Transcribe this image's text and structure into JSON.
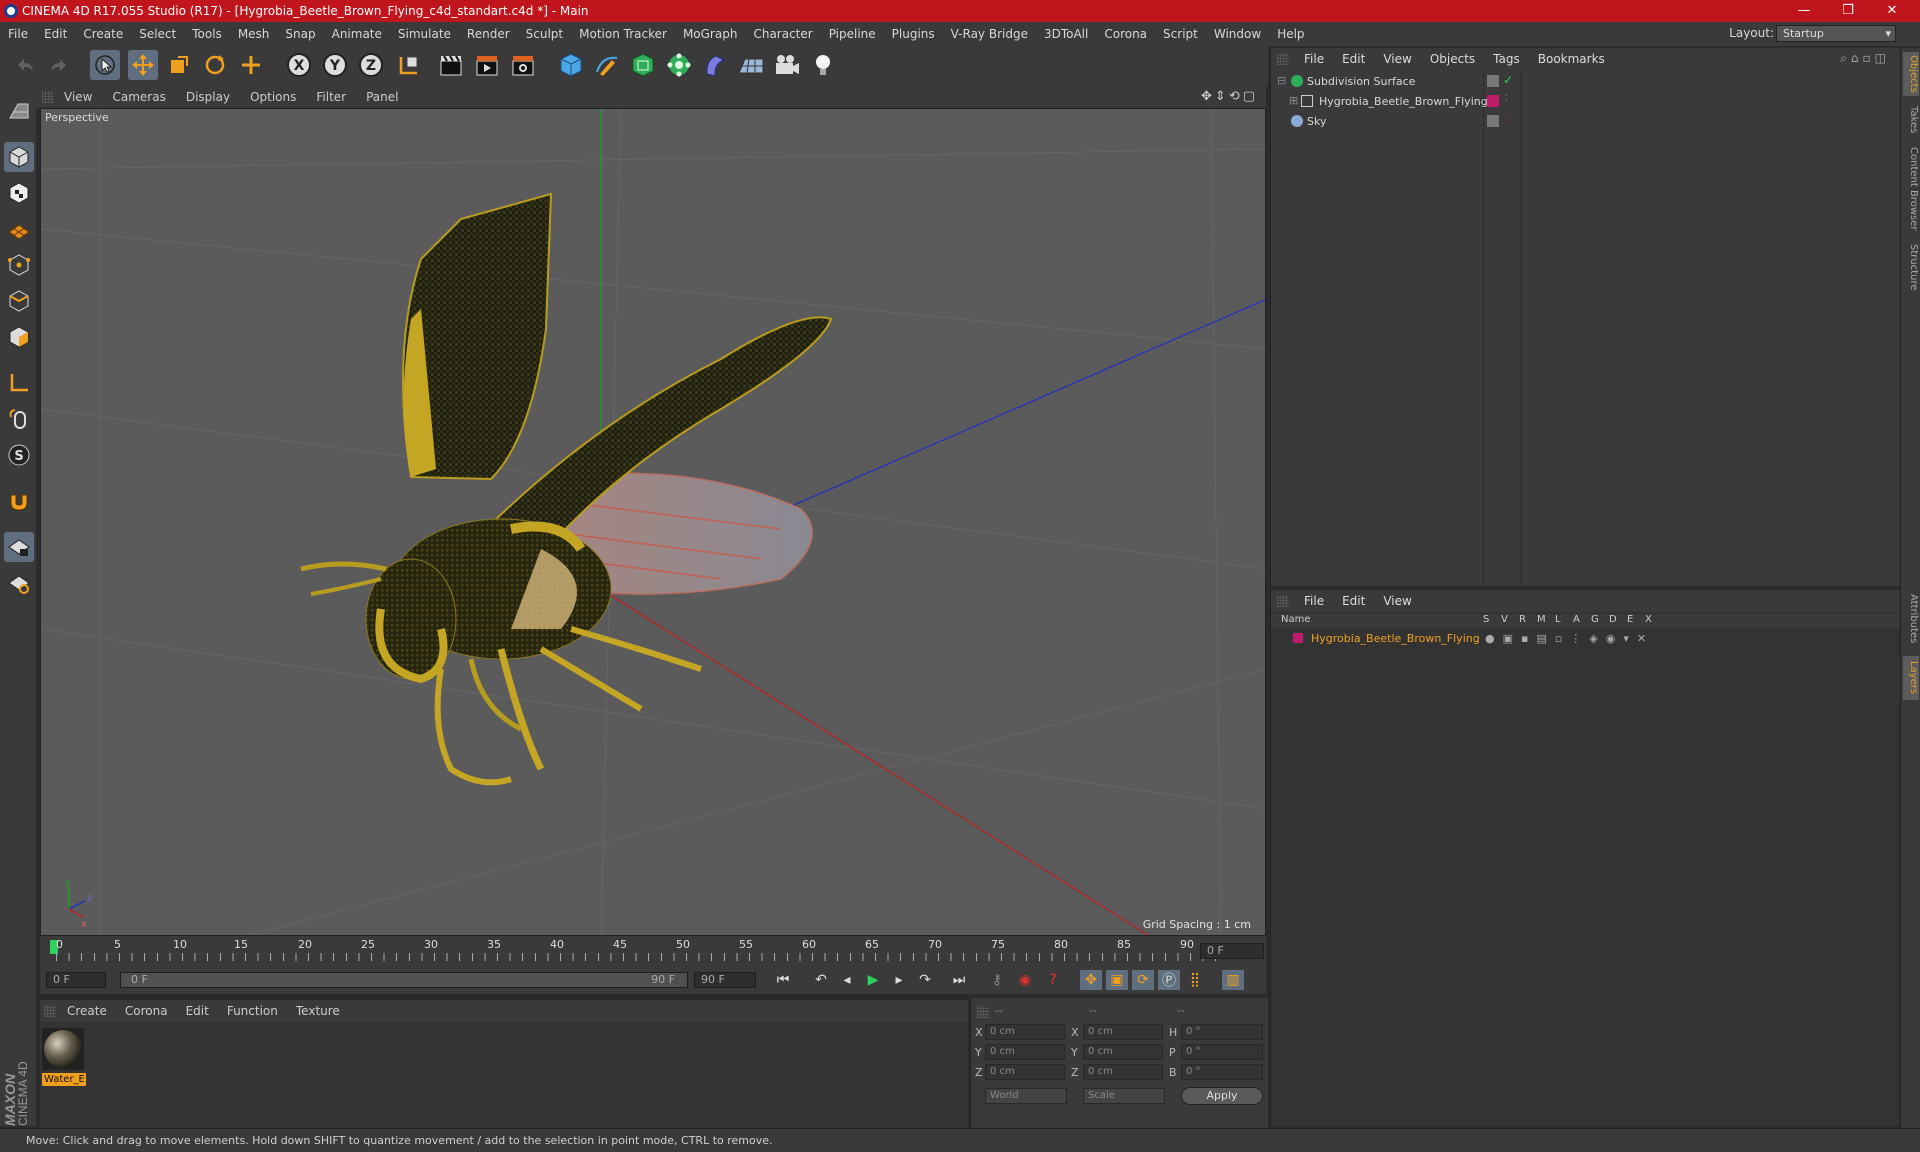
{
  "window": {
    "title": "CINEMA 4D R17.055 Studio (R17) - [Hygrobia_Beetle_Brown_Flying_c4d_standart.c4d *] - Main",
    "minimize": "—",
    "maximize": "❐",
    "close": "✕"
  },
  "menubar": {
    "items": [
      "File",
      "Edit",
      "Create",
      "Select",
      "Tools",
      "Mesh",
      "Snap",
      "Animate",
      "Simulate",
      "Render",
      "Sculpt",
      "Motion Tracker",
      "MoGraph",
      "Character",
      "Pipeline",
      "Plugins",
      "V-Ray Bridge",
      "3DToAll",
      "Corona",
      "Script",
      "Window",
      "Help"
    ],
    "layout_label": "Layout:",
    "layout_value": "Startup"
  },
  "toolbar": {
    "axis_x": "X",
    "axis_y": "Y",
    "axis_z": "Z"
  },
  "viewport": {
    "menu": [
      "View",
      "Cameras",
      "Display",
      "Options",
      "Filter",
      "Panel"
    ],
    "label": "Perspective",
    "grid_spacing": "Grid Spacing : 1 cm",
    "axis_y": "y",
    "axis_z": "z",
    "axis_x": "x"
  },
  "timeline": {
    "ticks": [
      "0",
      "5",
      "10",
      "15",
      "20",
      "25",
      "30",
      "35",
      "40",
      "45",
      "50",
      "55",
      "60",
      "65",
      "70",
      "75",
      "80",
      "85",
      "90"
    ],
    "current_frame": "0 F",
    "start_field": "0 F",
    "range_start": "0 F",
    "range_end": "90 F",
    "end_field": "90 F"
  },
  "material_manager": {
    "menu": [
      "Create",
      "Corona",
      "Edit",
      "Function",
      "Texture"
    ],
    "materials": [
      {
        "name": "Water_E"
      }
    ]
  },
  "coordinates": {
    "header": [
      "--",
      "--",
      "--"
    ],
    "rows": [
      {
        "a": "X",
        "av": "0 cm",
        "b": "X",
        "bv": "0 cm",
        "c": "H",
        "cv": "0 °"
      },
      {
        "a": "Y",
        "av": "0 cm",
        "b": "Y",
        "bv": "0 cm",
        "c": "P",
        "cv": "0 °"
      },
      {
        "a": "Z",
        "av": "0 cm",
        "b": "Z",
        "bv": "0 cm",
        "c": "B",
        "cv": "0 °"
      }
    ],
    "mode1": "World",
    "mode2": "Scale",
    "apply": "Apply"
  },
  "object_manager": {
    "menu": [
      "File",
      "Edit",
      "View",
      "Objects",
      "Tags",
      "Bookmarks"
    ],
    "objects": [
      {
        "name": "Subdivision Surface",
        "color": "#2fae5a"
      },
      {
        "name": "Hygrobia_Beetle_Brown_Flying",
        "color": "#c01a6a"
      },
      {
        "name": "Sky",
        "color": "#8aa8d8"
      }
    ]
  },
  "layer_manager": {
    "menu": [
      "File",
      "Edit",
      "View"
    ],
    "columns": [
      "Name",
      "S",
      "V",
      "R",
      "M",
      "L",
      "A",
      "G",
      "D",
      "E",
      "X"
    ],
    "layers": [
      {
        "name": "Hygrobia_Beetle_Brown_Flying",
        "color": "#c01a6a"
      }
    ]
  },
  "right_tabs": [
    "Objects",
    "Takes",
    "Content Browser",
    "Structure",
    "Attributes",
    "Layers"
  ],
  "statusbar": {
    "text": "Move: Click and drag to move elements. Hold down SHIFT to quantize movement / add to the selection in point mode, CTRL to remove."
  },
  "branding": {
    "line1": "MAXON",
    "line2": "CINEMA 4D"
  },
  "colors": {
    "titlebar": "#c0151d",
    "accent_orange": "#e0a030",
    "active_blue": "#5f6f80",
    "layer_name": "#f0a020"
  }
}
